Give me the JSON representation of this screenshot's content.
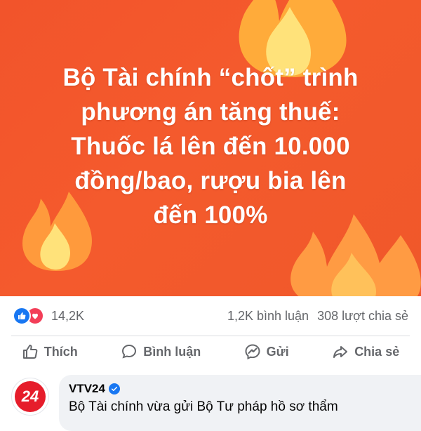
{
  "post": {
    "headline": "Bộ Tài chính “chốt” trình\nphương án tăng thuế:\nThuốc lá lên đến 10.000\nđồng/bao, rượu bia lên\nđến 100%"
  },
  "stats": {
    "reaction_count": "14,2K",
    "comments": "1,2K bình luận",
    "shares": "308 lượt chia sẻ"
  },
  "actions": {
    "like": "Thích",
    "comment": "Bình luận",
    "send": "Gửi",
    "share": "Chia sẻ"
  },
  "comment": {
    "avatar_text": "24",
    "author": "VTV24",
    "text": "Bộ Tài chính vừa gửi Bộ Tư pháp hồ sơ thẩm"
  },
  "colors": {
    "banner": "#f2542b",
    "flame_outer": "#ff8a3d",
    "flame_inner": "#ffd166",
    "facebook_blue": "#1877f2",
    "love_red": "#f33e58",
    "vtv24_red": "#e61d2b"
  },
  "icons": [
    "flame-icon",
    "like-reaction-icon",
    "love-reaction-icon",
    "thumbs-up-icon",
    "comment-icon",
    "messenger-icon",
    "share-icon",
    "verified-icon"
  ]
}
